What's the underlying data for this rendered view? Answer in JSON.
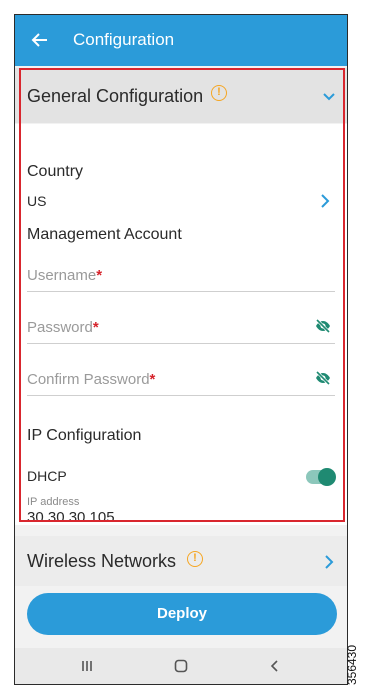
{
  "appbar": {
    "title": "Configuration"
  },
  "general": {
    "section_label": "General Configuration",
    "country_label": "Country",
    "country_value": "US",
    "mgmt_label": "Management Account",
    "username_placeholder": "Username",
    "password_placeholder": "Password",
    "confirm_placeholder": "Confirm Password",
    "required_mark": "*",
    "ip_config_label": "IP Configuration",
    "dhcp_label": "DHCP",
    "dhcp_enabled": true,
    "ip_address_label": "IP address",
    "ip_address_value": "30.30.30.105"
  },
  "wireless": {
    "section_label": "Wireless Networks"
  },
  "actions": {
    "deploy_label": "Deploy"
  },
  "figure_id": "356430",
  "colors": {
    "primary": "#2b9bd9",
    "warning": "#f5a623",
    "required": "#d6232b",
    "toggle_on": "#1f8a72",
    "highlight": "#d9262e"
  },
  "icons": [
    "back-arrow-icon",
    "warning-icon",
    "chevron-down-icon",
    "chevron-right-icon",
    "eye-off-icon",
    "recents-icon",
    "home-icon",
    "back-icon"
  ]
}
